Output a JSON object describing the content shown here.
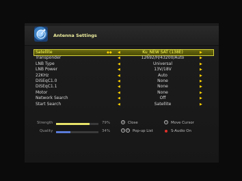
{
  "header": {
    "title": "Antenna Settings"
  },
  "settings": [
    {
      "label": "Satellite",
      "value": "Ku_NEW SAT (138E)",
      "marker": "◆◆"
    },
    {
      "label": "Transponder",
      "value": "12692/H/43200/Auto",
      "marker": ""
    },
    {
      "label": "LNB Type",
      "value": "Universal",
      "marker": ""
    },
    {
      "label": "LNB Power",
      "value": "13V/18V",
      "marker": ""
    },
    {
      "label": "22KHz",
      "value": "Auto",
      "marker": ""
    },
    {
      "label": "DiSEqC1.0",
      "value": "None",
      "marker": ""
    },
    {
      "label": "DiSEqC1.1",
      "value": "None",
      "marker": ""
    },
    {
      "label": "Motor",
      "value": "None",
      "marker": ""
    },
    {
      "label": "Network Search",
      "value": "Off",
      "marker": ""
    },
    {
      "label": "Start Search",
      "value": "Satellite",
      "marker": ""
    }
  ],
  "signal": {
    "strength": {
      "label": "Strength",
      "percent_text": "79%",
      "level": 0.79
    },
    "quality": {
      "label": "Quality",
      "percent_text": "34%",
      "level": 0.34
    }
  },
  "legend": {
    "close": "Close",
    "move_cursor": "Move Cursor",
    "popup_list": "Pop-up List",
    "s_audio_on": "S-Audio On"
  },
  "colors": {
    "strength_bar": "#e7e36a",
    "quality_bar": "#5a7bd8",
    "accent_yellow": "#ffd200",
    "audio_dot": "#e0302a"
  },
  "icons": {
    "arrow_left": "◀",
    "arrow_right": "▶"
  }
}
